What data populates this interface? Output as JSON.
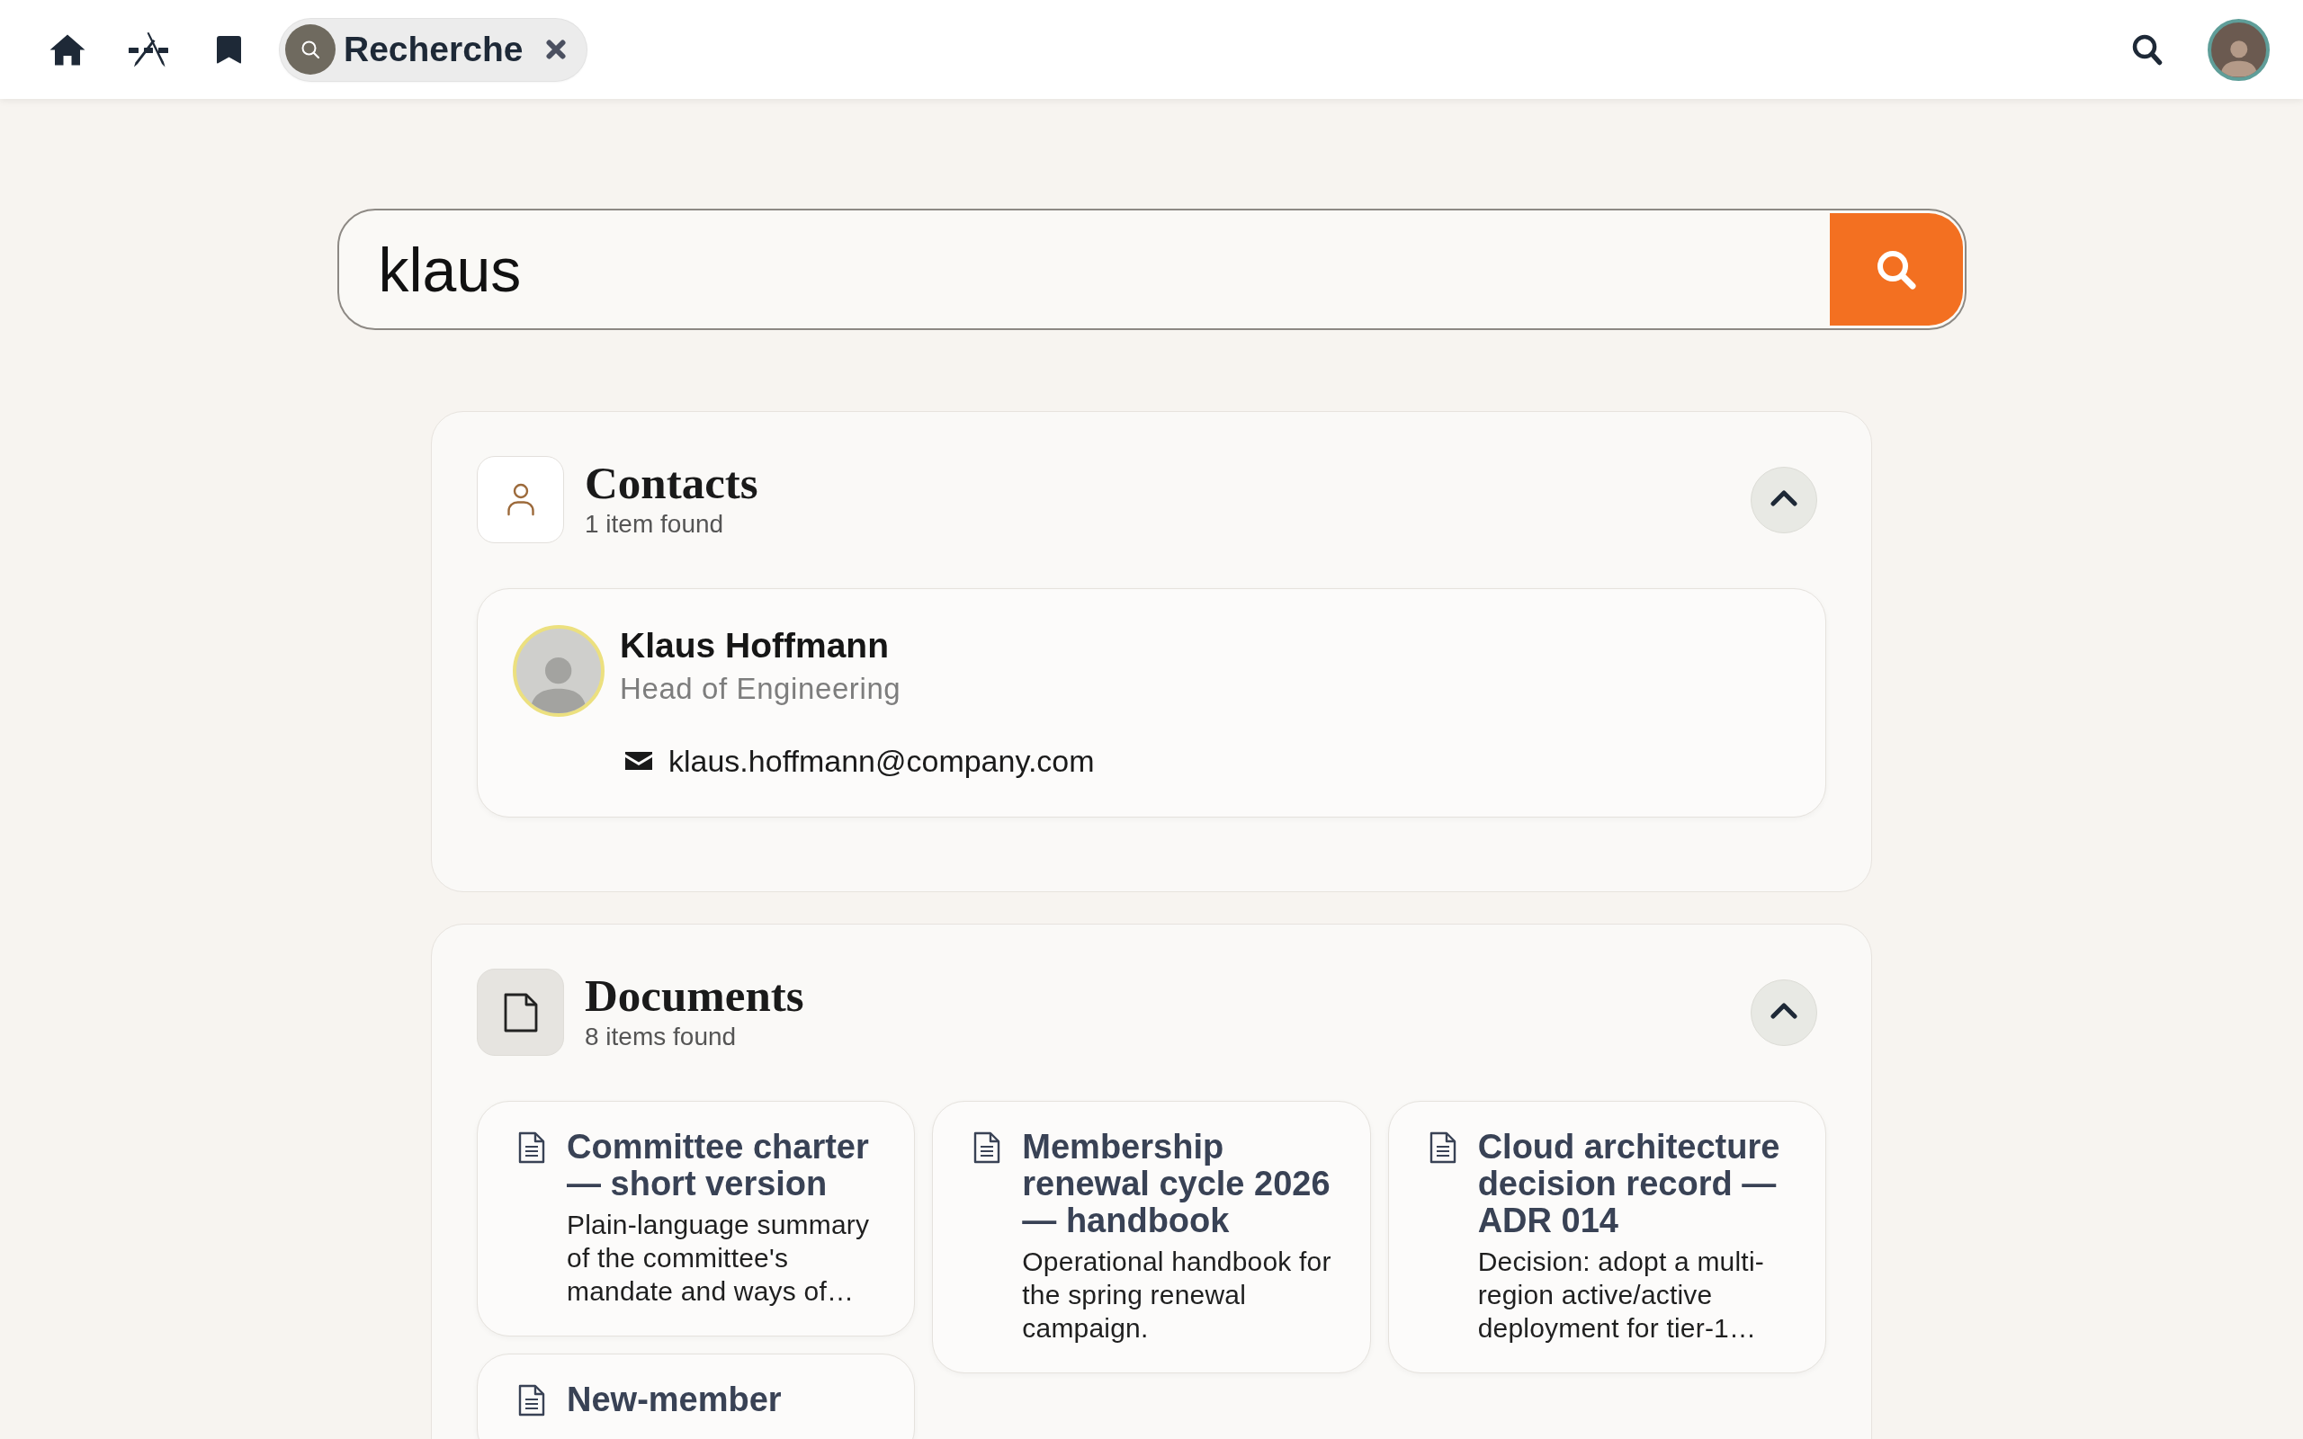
{
  "top_bar": {
    "tab": {
      "label": "Recherche"
    }
  },
  "search": {
    "value": "klaus"
  },
  "sections": [
    {
      "kind": "contacts",
      "title": "Contacts",
      "count": "1 item found",
      "expanded": true,
      "items": [
        {
          "name": "Klaus Hoffmann",
          "role": "Head of Engineering",
          "email": "klaus.hoffmann@company.com"
        }
      ]
    },
    {
      "kind": "documents",
      "title": "Documents",
      "count": "8 items found",
      "expanded": true,
      "items": [
        {
          "title": "Committee charter — short version",
          "description": "Plain-language summary of the committee's mandate and ways of…"
        },
        {
          "title": "Membership renewal cycle 2026 — handbook",
          "description": "Operational handbook for the spring renewal campaign."
        },
        {
          "title": "Cloud architecture decision record — ADR 014",
          "description": "Decision: adopt a multi-region active/active deployment for tier-1…"
        },
        {
          "title": "New-member"
        }
      ]
    }
  ]
}
